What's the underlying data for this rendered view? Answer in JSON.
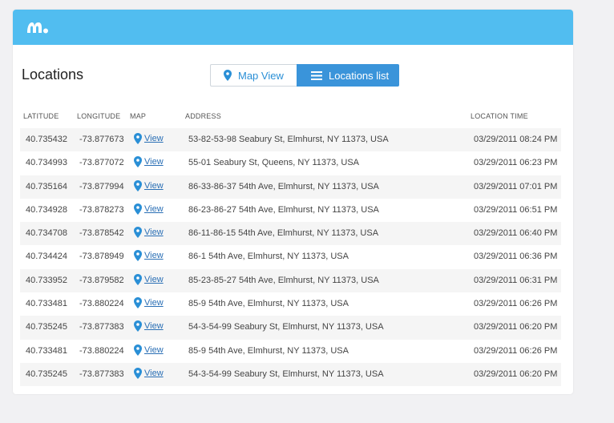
{
  "app": {
    "logo_icon": "mspy-logo",
    "topbar_color": "#51bdf0"
  },
  "page": {
    "title": "Locations"
  },
  "view_toggle": {
    "map_view_label": "Map View",
    "list_label": "Locations list",
    "active": "Locations list"
  },
  "table": {
    "headers": {
      "latitude": "LATITUDE",
      "longitude": "LONGITUDE",
      "map": "MAP",
      "address": "ADDRESS",
      "time": "LOCATION TIME"
    },
    "rows": [
      {
        "lat": "40.735432",
        "lon": "-73.877673",
        "map": "View",
        "address": "53-82-53-98 Seabury St, Elmhurst, NY 11373, USA",
        "time": "03/29/2011 08:24 PM"
      },
      {
        "lat": "40.734993",
        "lon": "-73.877072",
        "map": "View",
        "address": "55-01 Seabury St, Queens, NY 11373, USA",
        "time": "03/29/2011 06:23 PM"
      },
      {
        "lat": "40.735164",
        "lon": "-73.877994",
        "map": "View",
        "address": "86-33-86-37 54th Ave, Elmhurst, NY 11373, USA",
        "time": "03/29/2011 07:01 PM"
      },
      {
        "lat": "40.734928",
        "lon": "-73.878273",
        "map": "View",
        "address": "86-23-86-27 54th Ave, Elmhurst, NY 11373, USA",
        "time": "03/29/2011 06:51 PM"
      },
      {
        "lat": "40.734708",
        "lon": "-73.878542",
        "map": "View",
        "address": "86-11-86-15 54th Ave, Elmhurst, NY 11373, USA",
        "time": "03/29/2011 06:40 PM"
      },
      {
        "lat": "40.734424",
        "lon": "-73.878949",
        "map": "View",
        "address": "86-1 54th Ave, Elmhurst, NY 11373, USA",
        "time": "03/29/2011 06:36 PM"
      },
      {
        "lat": "40.733952",
        "lon": "-73.879582",
        "map": "View",
        "address": "85-23-85-27 54th Ave, Elmhurst, NY 11373, USA",
        "time": "03/29/2011 06:31 PM"
      },
      {
        "lat": "40.733481",
        "lon": "-73.880224",
        "map": "View",
        "address": "85-9 54th Ave, Elmhurst, NY 11373, USA",
        "time": "03/29/2011 06:26 PM"
      },
      {
        "lat": "40.735245",
        "lon": "-73.877383",
        "map": "View",
        "address": "54-3-54-99 Seabury St, Elmhurst, NY 11373, USA",
        "time": "03/29/2011 06:20 PM"
      },
      {
        "lat": "40.733481",
        "lon": "-73.880224",
        "map": "View",
        "address": "85-9 54th Ave, Elmhurst, NY 11373, USA",
        "time": "03/29/2011 06:26 PM"
      },
      {
        "lat": "40.735245",
        "lon": "-73.877383",
        "map": "View",
        "address": "54-3-54-99 Seabury St, Elmhurst, NY 11373, USA",
        "time": "03/29/2011 06:20 PM"
      }
    ]
  }
}
